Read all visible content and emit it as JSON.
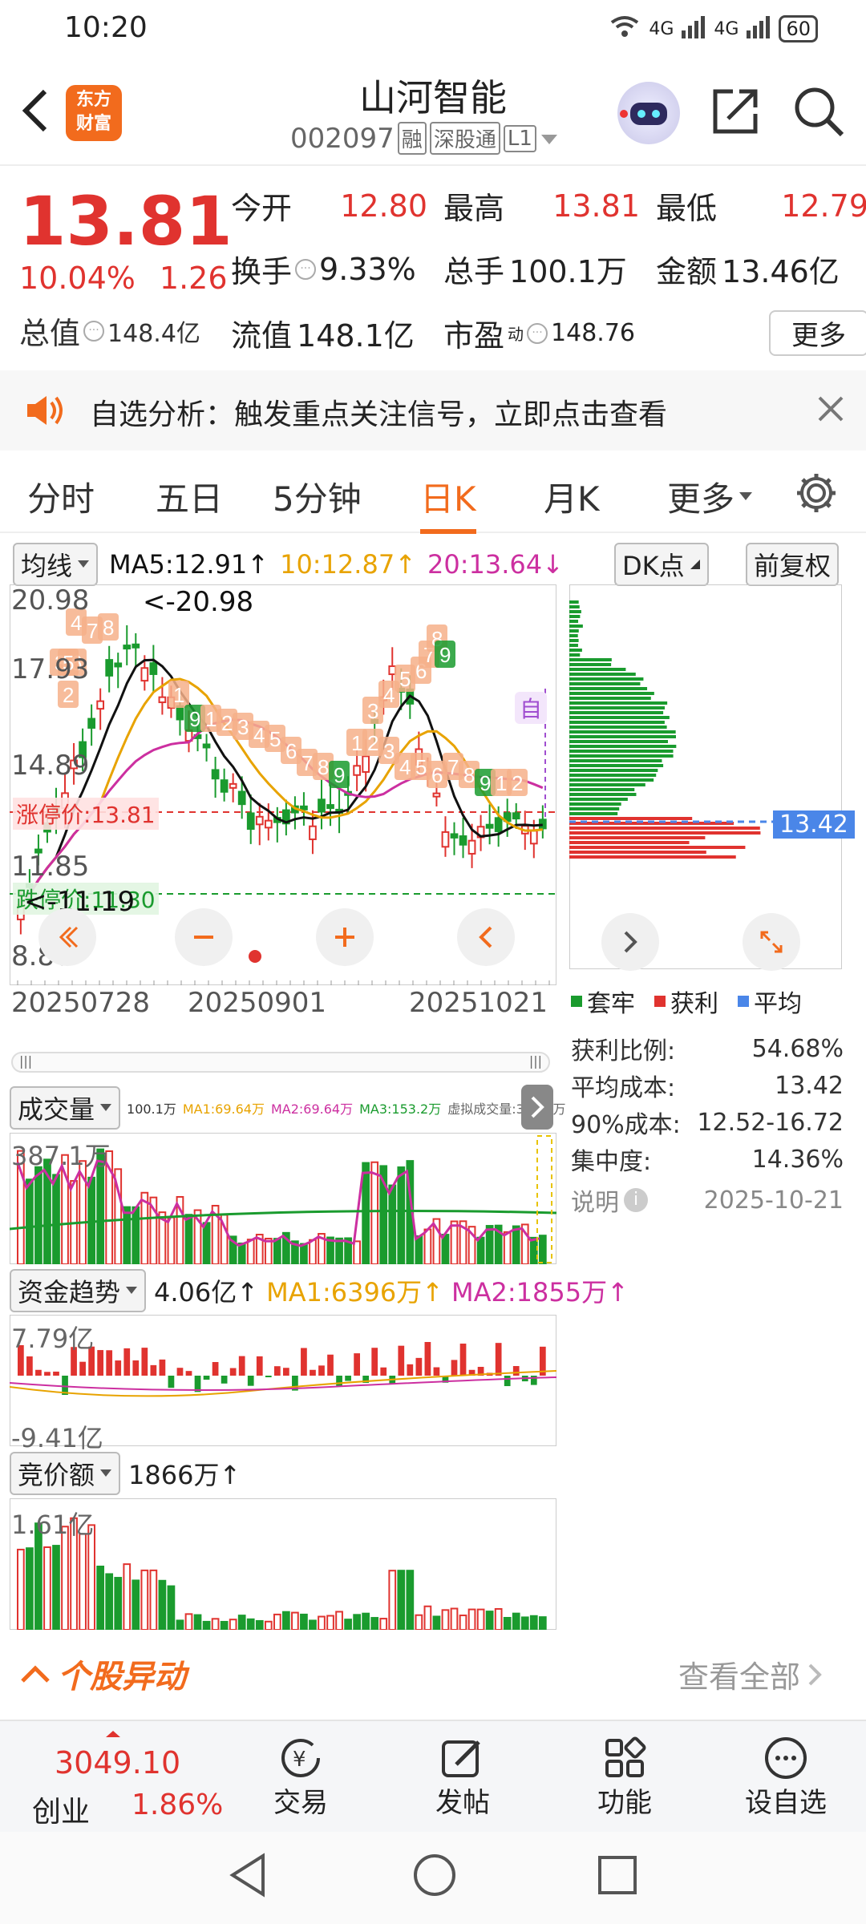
{
  "status": {
    "time": "10:20",
    "signal1": "4G",
    "signal2": "4G",
    "battery": "60"
  },
  "header": {
    "back_icon": "chevron-left-icon",
    "logo_line1": "东方",
    "logo_line2": "财富",
    "title": "山河智能",
    "code": "002097",
    "tag_rong": "融",
    "tag_sgt": "深股通",
    "tag_level": "L1"
  },
  "quote": {
    "price": "13.81",
    "change_pct": "10.04%",
    "change": "1.26",
    "open_label": "今开",
    "open": "12.80",
    "high_label": "最高",
    "high": "13.81",
    "low_label": "最低",
    "low": "12.79",
    "turnover_label": "换手",
    "turnover": "9.33%",
    "volume_label": "总手",
    "volume": "100.1万",
    "amount_label": "金额",
    "amount": "13.46亿",
    "mktcap_label": "总值",
    "mktcap": "148.4亿",
    "float_label": "流值",
    "float": "148.1亿",
    "pe_label": "市盈",
    "pe_sup": "动",
    "pe": "148.76",
    "more_button": "更多"
  },
  "banner": {
    "text": "自选分析：触发重点关注信号，立即点击查看"
  },
  "tabs": [
    "分时",
    "五日",
    "5分钟",
    "日K",
    "月K",
    "更多"
  ],
  "active_tab": "日K",
  "indicator_bar": {
    "ma_select": "均线",
    "ma5": "MA5:12.91↑",
    "ma10": "10:12.87↑",
    "ma20": "20:13.64↓",
    "dk_button": "DK点",
    "adj_button": "前复权"
  },
  "kline": {
    "y_top": "20.98",
    "y_2": "17.93",
    "y_3": "14.89",
    "y_4": "11.85",
    "y_bottom": "8.80",
    "max_note": "<-20.98",
    "limit_up": "涨停价:13.81",
    "limit_down": "跌停价:11.30",
    "min_note": "<-11.19",
    "self_tag": "自",
    "dates": [
      "20250728",
      "20250901",
      "20251021"
    ],
    "markers": [
      "4",
      "7",
      "8",
      "3",
      "6",
      "5",
      "2",
      "1",
      "9",
      "1",
      "2",
      "3",
      "4",
      "5",
      "6",
      "7",
      "8",
      "9",
      "1",
      "2",
      "3",
      "4",
      "5",
      "6",
      "7",
      "8",
      "9",
      "1",
      "2",
      "3",
      "4",
      "5",
      "6",
      "7",
      "8",
      "9"
    ]
  },
  "volume": {
    "select": "成交量",
    "v": "100.1万",
    "ma1": "MA1:69.64万",
    "ma2": "MA2:69.64万",
    "ma3": "MA3:153.2万",
    "virtual": "虚拟成交量:358.1万",
    "y_top": "387.1万"
  },
  "fund": {
    "select": "资金趋势",
    "value": "4.06亿↑",
    "ma1": "MA1:6396万↑",
    "ma2": "MA2:1855万↑",
    "y_top": "7.79亿",
    "y_bottom": "-9.41亿"
  },
  "auction": {
    "select": "竞价额",
    "value": "1866万↑",
    "y_top": "1.61亿"
  },
  "chip": {
    "price_tag": "13.42",
    "legend": [
      "套牢",
      "获利",
      "平均"
    ],
    "rows": [
      {
        "label": "获利比例:",
        "value": "54.68%"
      },
      {
        "label": "平均成本:",
        "value": "13.42"
      },
      {
        "label": "90%成本:",
        "value": "12.52-16.72"
      },
      {
        "label": "集中度:",
        "value": "14.36%"
      }
    ],
    "note_label": "说明",
    "date": "2025-10-21"
  },
  "movement": {
    "title": "个股异动",
    "view_all": "查看全部"
  },
  "bottom_nav": {
    "index_value": "3049.10",
    "index_name": "创业",
    "index_change": "1.86%",
    "items": [
      "交易",
      "发帖",
      "功能",
      "设自选"
    ]
  },
  "colors": {
    "up": "#e0332f",
    "down": "#1a9b2e",
    "accent": "#f26b1d",
    "ma5": "#111111",
    "ma10": "#e8a300",
    "ma20": "#cc2fa0"
  },
  "chart_data": {
    "type": "candlestick",
    "price_range": [
      8.8,
      20.98
    ],
    "latest": {
      "open": 12.8,
      "high": 13.81,
      "low": 12.79,
      "close": 13.81
    },
    "chip_avg_cost": 13.42
  }
}
